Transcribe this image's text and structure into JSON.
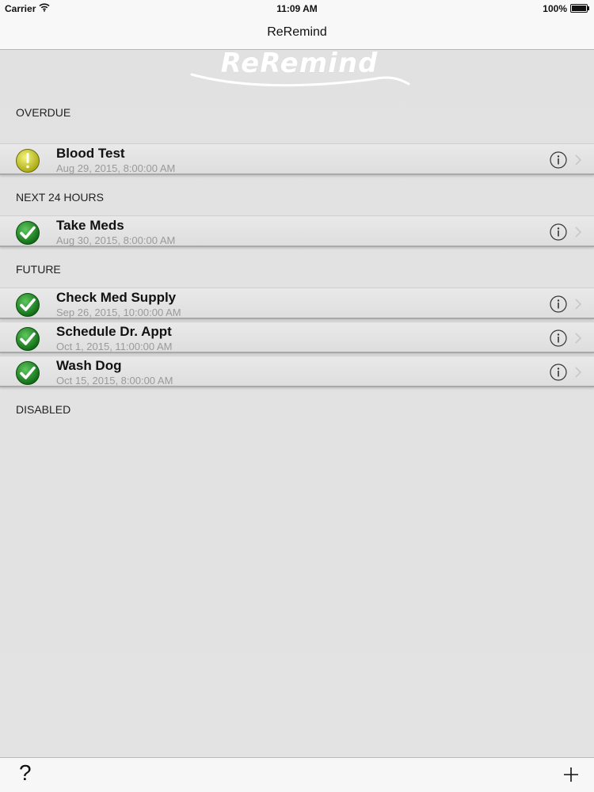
{
  "status_bar": {
    "carrier": "Carrier",
    "time": "11:09 AM",
    "battery": "100%"
  },
  "nav": {
    "title": "ReRemind"
  },
  "logo": {
    "text": "ReRemind"
  },
  "sections": {
    "overdue": {
      "header": "OVERDUE",
      "items": [
        {
          "title": "Blood Test",
          "date": "Aug 29, 2015, 8:00:00 AM",
          "status": "warning-icon"
        }
      ]
    },
    "next24": {
      "header": "NEXT 24 HOURS",
      "items": [
        {
          "title": "Take Meds",
          "date": "Aug 30, 2015, 8:00:00 AM",
          "status": "checkmark-icon"
        }
      ]
    },
    "future": {
      "header": "FUTURE",
      "items": [
        {
          "title": "Check Med Supply",
          "date": "Sep 26, 2015, 10:00:00 AM",
          "status": "checkmark-icon"
        },
        {
          "title": "Schedule Dr. Appt",
          "date": "Oct 1, 2015, 11:00:00 AM",
          "status": "checkmark-icon"
        },
        {
          "title": "Wash Dog",
          "date": "Oct 15, 2015, 8:00:00 AM",
          "status": "checkmark-icon"
        }
      ]
    },
    "disabled": {
      "header": "DISABLED",
      "items": []
    }
  },
  "toolbar": {
    "help_label": "?",
    "add_icon": "plus-icon"
  },
  "colors": {
    "warning": "#c9c922",
    "success": "#1f8a1f",
    "background": "#e2e2e2",
    "bar": "#f8f8f8"
  }
}
